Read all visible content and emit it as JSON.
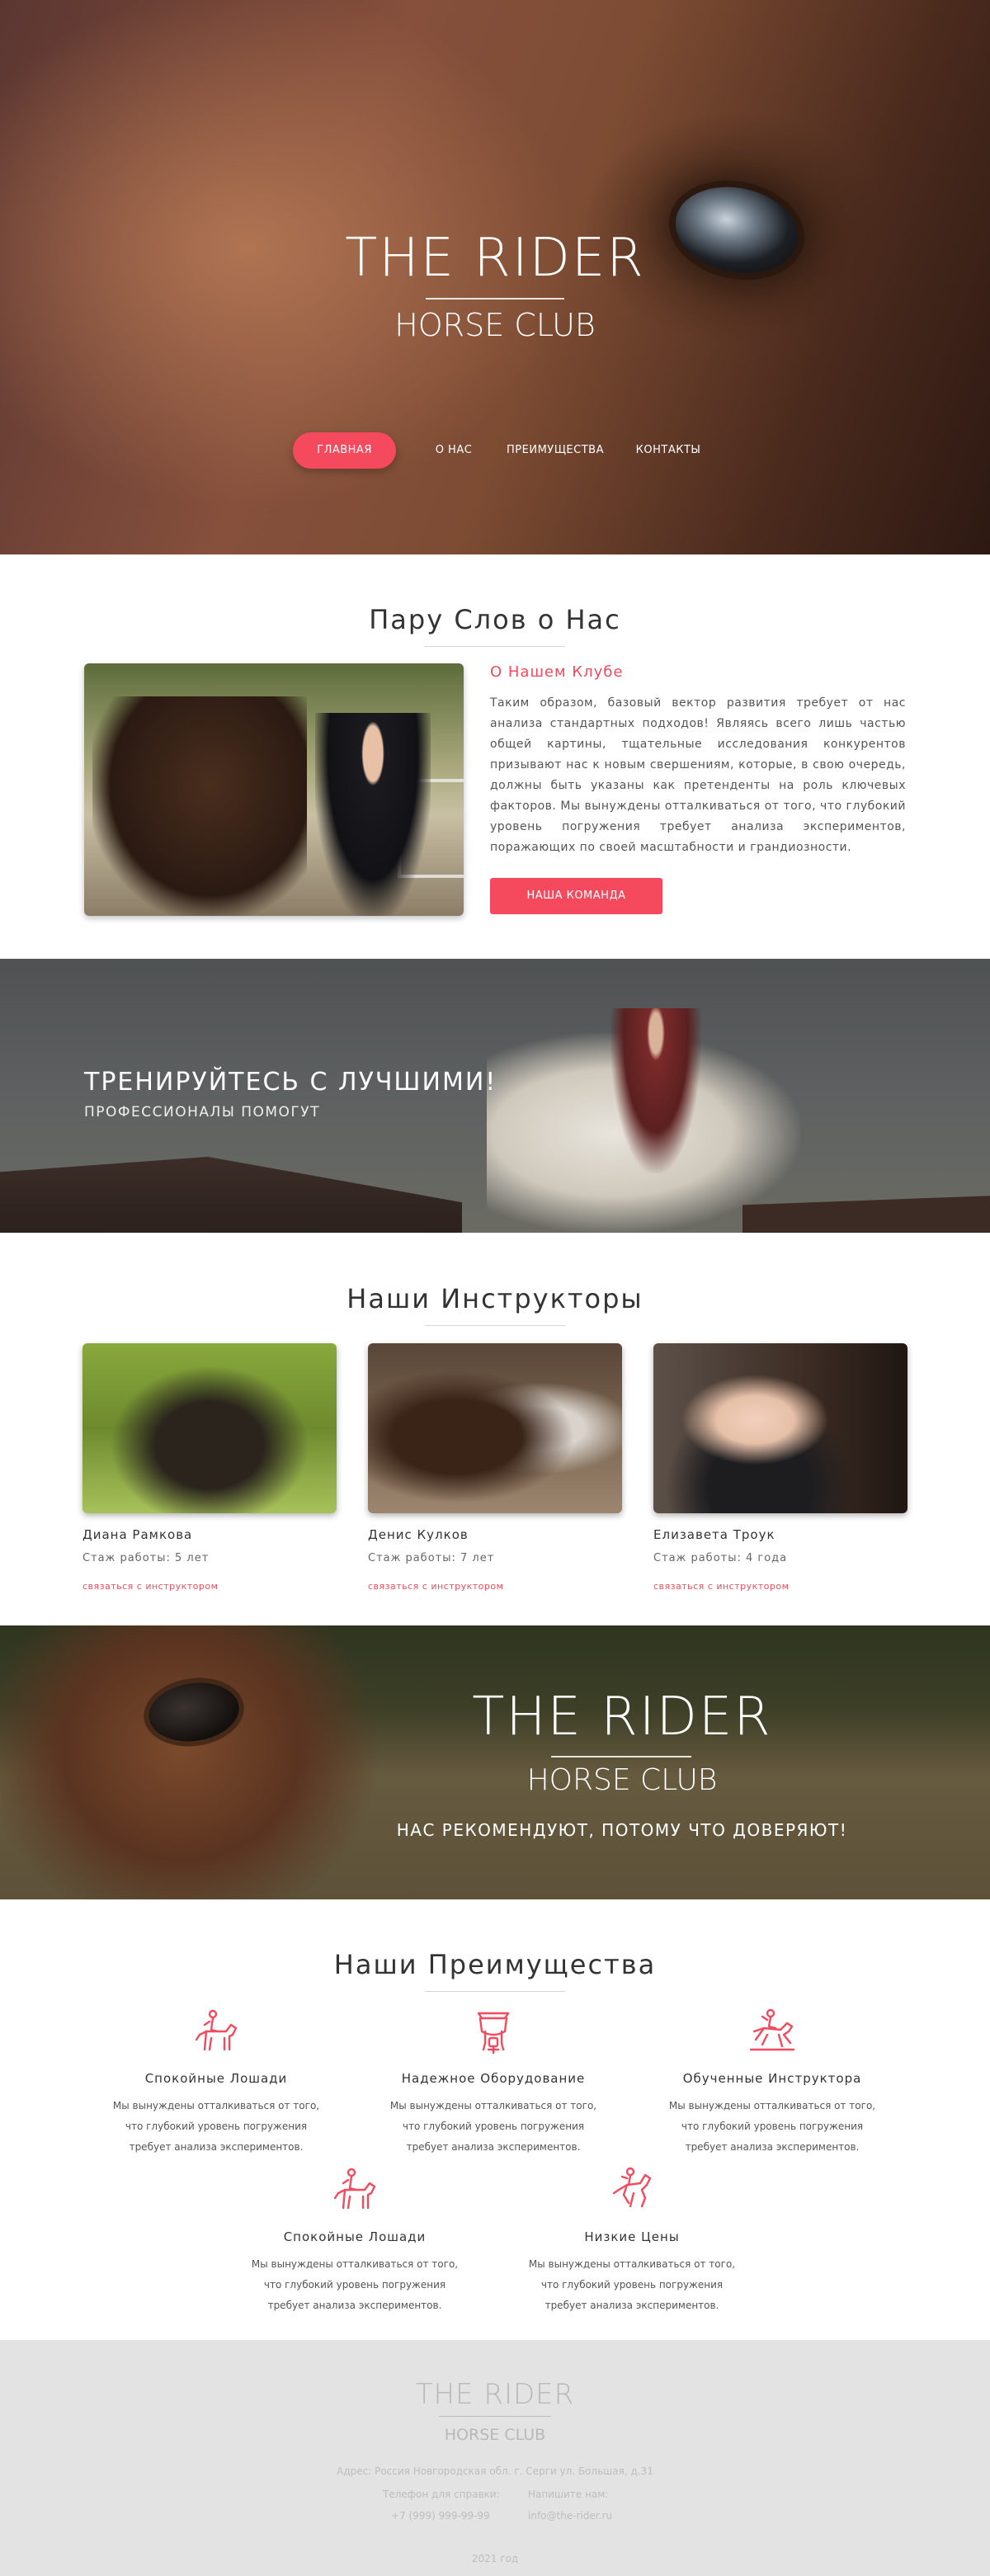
{
  "hero": {
    "title": "THE RIDER",
    "subtitle": "HORSE CLUB",
    "nav": [
      "ГЛАВНАЯ",
      "О НАС",
      "ПРЕИМУЩЕСТВА",
      "КОНТАКТЫ"
    ]
  },
  "about": {
    "section_title": "Пару Слов о Нас",
    "heading": "О Нашем Клубе",
    "text": "Таким образом, базовый вектор развития требует от нас анализа стандартных подходов! Являясь всего лишь частью общей картины, тщательные исследования конкурентов призывают нас к новым свершениям, которые, в свою очередь, должны быть указаны как претенденты на роль ключевых факторов. Мы вынуждены отталкиваться от того, что глубокий уровень погружения требует анализа экспериментов, поражающих по своей масштабности и грандиозности.",
    "button": "НАША КОМАНДА"
  },
  "banner1": {
    "title": "ТРЕНИРУЙТЕСЬ С ЛУЧШИМИ!",
    "subtitle": "ПРОФЕССИОНАЛЫ ПОМОГУТ"
  },
  "instructors": {
    "section_title": "Наши Инструкторы",
    "items": [
      {
        "name": "Диана Рамкова",
        "experience": "Стаж работы: 5 лет",
        "link": "связаться с инструктором"
      },
      {
        "name": "Денис Кулков",
        "experience": "Стаж работы: 7 лет",
        "link": "связаться с инструктором"
      },
      {
        "name": "Елизавета Троук",
        "experience": "Стаж работы: 4 года",
        "link": "связаться с инструктором"
      }
    ]
  },
  "banner2": {
    "title": "THE RIDER",
    "subtitle": "HORSE CLUB",
    "tagline": "НАС РЕКОМЕНДУЮТ, ПОТОМУ ЧТО ДОВЕРЯЮТ!"
  },
  "advantages": {
    "section_title": "Наши Преимущества",
    "items": [
      {
        "icon": "horse-rider-icon",
        "title": "Спокойные Лошади",
        "lines": [
          "Мы вынуждены отталкиваться от того,",
          "что глубокий уровень погружения",
          "требует анализа экспериментов."
        ]
      },
      {
        "icon": "saddle-icon",
        "title": "Надежное Оборудование",
        "lines": [
          "Мы вынуждены отталкиваться от того,",
          "что глубокий уровень погружения",
          "требует анализа экспериментов."
        ]
      },
      {
        "icon": "jumping-rider-icon",
        "title": "Обученные Инструктора",
        "lines": [
          "Мы вынуждены отталкиваться от того,",
          "что глубокий уровень погружения",
          "требует анализа экспериментов."
        ]
      },
      {
        "icon": "horse-rider-icon",
        "title": "Спокойные Лошади",
        "lines": [
          "Мы вынуждены отталкиваться от того,",
          "что глубокий уровень погружения",
          "требует анализа экспериментов."
        ]
      },
      {
        "icon": "rearing-horse-icon",
        "title": "Низкие Цены",
        "lines": [
          "Мы вынуждены отталкиваться от того,",
          "что глубокий уровень погружения",
          "требует анализа экспериментов."
        ]
      }
    ]
  },
  "footer": {
    "title": "THE RIDER",
    "subtitle": "HORSE CLUB",
    "address": "Адрес: Россия Новгородская обл. г. Серги ул. Большая, д.31",
    "phone_label": "Телефон для справки:",
    "phone": "+7 (999) 999-99-99",
    "email_label": "Напишите нам:",
    "email": "info@the-rider.ru",
    "year": "2021 год"
  },
  "colors": {
    "accent": "#f5495d",
    "footer_bg": "#e3e3e3"
  }
}
